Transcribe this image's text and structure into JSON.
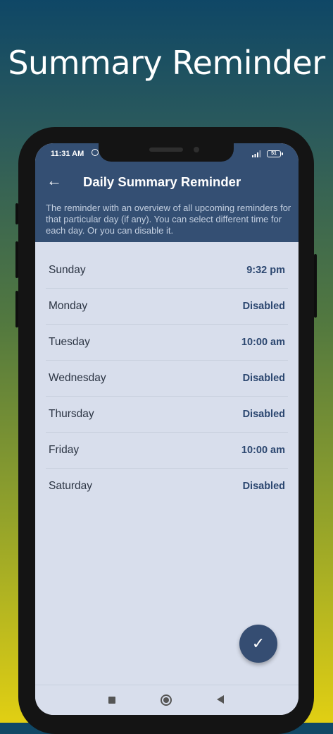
{
  "promo": {
    "title": "Summary Reminder"
  },
  "status_bar": {
    "time": "11:31 AM",
    "battery": "51"
  },
  "app_bar": {
    "title": "Daily Summary Reminder",
    "description": "The reminder with an overview of all upcoming reminders for that particular day (if any). You can select different time for each day. Or you can disable it."
  },
  "days": [
    {
      "day": "Sunday",
      "value": "9:32 pm"
    },
    {
      "day": "Monday",
      "value": "Disabled"
    },
    {
      "day": "Tuesday",
      "value": "10:00 am"
    },
    {
      "day": "Wednesday",
      "value": "Disabled"
    },
    {
      "day": "Thursday",
      "value": "Disabled"
    },
    {
      "day": "Friday",
      "value": "10:00 am"
    },
    {
      "day": "Saturday",
      "value": "Disabled"
    }
  ],
  "icons": {
    "back": "arrow-left-icon",
    "fab": "check-icon",
    "alarm": "alarm-icon",
    "signal": "signal-icon",
    "battery": "battery-icon"
  },
  "colors": {
    "app_bar": "#344f73",
    "screen_bg": "#d8deec",
    "value_text": "#2c4770",
    "fab": "#354d72"
  }
}
